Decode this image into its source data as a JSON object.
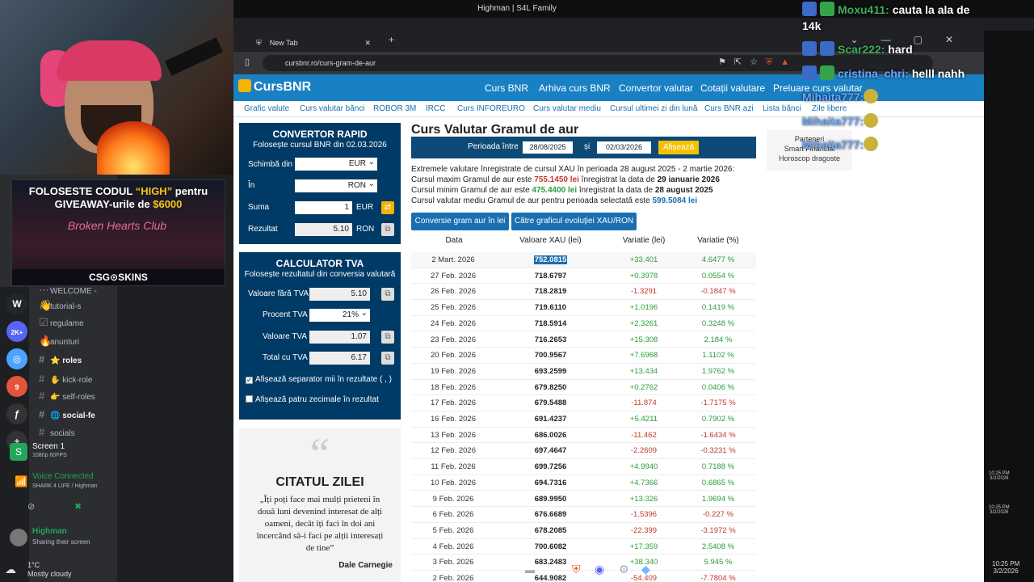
{
  "window_title": "Highman | S4L Family",
  "browser": {
    "tab_title": "New Tab",
    "url": "cursbnr.ro/curs-gram-de-aur"
  },
  "promo": {
    "line1_pre": "FOLOSESTE CODUL ",
    "line1_code": "“HIGH”",
    "line1_post": " pentru",
    "line2_pre": "GIVEAWAY-urile de ",
    "line2_amount": "$6000",
    "club": "Broken Hearts Club",
    "brand": "CSG⊙SKINS"
  },
  "discord": {
    "channels": [
      {
        "icon": "⋯",
        "name": "WELCOME -",
        "bold": false
      },
      {
        "icon": "👋",
        "name": "tutorial-s",
        "bold": false
      },
      {
        "icon": "☑",
        "name": "regulame",
        "bold": false
      },
      {
        "icon": "🔥",
        "name": "anunturi",
        "bold": false
      },
      {
        "icon": "#",
        "name": "⭐ roles",
        "bold": true
      },
      {
        "icon": "#",
        "name": "✋ kick-role",
        "bold": false
      },
      {
        "icon": "#",
        "name": "👉 self-roles",
        "bold": false
      },
      {
        "icon": "#",
        "name": "🌐 social-fe",
        "bold": true
      },
      {
        "icon": "#",
        "name": "socials",
        "bold": false
      }
    ],
    "server_badges": [
      "2K+",
      "9",
      "2"
    ],
    "screen_title": "Screen 1",
    "screen_sub": "1080p 60FPS",
    "voice_title": "Voice Connected",
    "voice_sub": "SHARK 4 LIFE / Highman",
    "user_name": "Highman",
    "user_status": "Sharing their screen",
    "weather_temp": "1°C",
    "weather_desc": "Mostly cloudy"
  },
  "site": {
    "logo": "CursBNR",
    "nav": [
      "Curs BNR",
      "Arhiva curs BNR",
      "Convertor valutar",
      "Cotații valutare",
      "Preluare curs valutar"
    ],
    "subnav": [
      "Grafic valute",
      "Curs valutar bănci",
      "ROBOR 3M",
      "IRCC",
      "Curs INFOREURO",
      "Curs valutar mediu",
      "Cursul ultimei zi din lună",
      "Curs BNR azi",
      "Lista bănci",
      "Zile libere"
    ]
  },
  "convertor": {
    "title": "CONVERTOR RAPID",
    "subtitle": "Folosește cursul BNR din 02.03.2026",
    "from_label": "Schimbă din",
    "from_value": "EUR",
    "to_label": "În",
    "to_value": "RON",
    "sum_label": "Suma",
    "sum_value": "1",
    "sum_unit": "EUR",
    "result_label": "Rezultat",
    "result_value": "5.10",
    "result_unit": "RON"
  },
  "tva": {
    "title": "CALCULATOR TVA",
    "subtitle": "Folosește rezultatul din conversia valutară",
    "rows": [
      {
        "label": "Valoare fără TVA",
        "value": "5.10"
      },
      {
        "label": "Procent TVA",
        "value": "21%"
      },
      {
        "label": "Valoare TVA",
        "value": "1.07"
      },
      {
        "label": "Total cu TVA",
        "value": "6.17"
      }
    ],
    "chk1": "Afișează separator mii în rezultate ( , )",
    "chk2": "Afișează patru zecimale în rezultat"
  },
  "quote": {
    "mark": "“",
    "title": "CITATUL ZILEI",
    "text": "„Îți poți face mai mulți prieteni în două luni devenind interesat de alți oameni, decât îți faci în doi ani încercând să-i faci pe alții interesați de tine”",
    "author": "Dale Carnegie"
  },
  "main": {
    "title": "Curs Valutar Gramul de aur",
    "period_label": "Perioada între",
    "date_from": "28/08/2025",
    "and": "și",
    "date_to": "02/03/2026",
    "show_btn": "Afișează",
    "info1": "Extremele valutare înregistrate de cursul XAU în perioada 28 august 2025 - 2 martie 2026:",
    "info2_pre": "Cursul maxim Gramul de aur este ",
    "info2_val": "755.1450 lei",
    "info2_mid": " înregistrat la data de ",
    "info2_date": "29 ianuarie 2026",
    "info3_pre": "Cursul minim Gramul de aur este ",
    "info3_val": "475.4400 lei",
    "info3_mid": " înregistrat la data de ",
    "info3_date": "28 august 2025",
    "info4_pre": "Cursul valutar mediu Gramul de aur pentru perioada selectată este ",
    "info4_val": "599.5084 lei",
    "btn1": "Conversie gram aur în lei",
    "btn2": "Către graficul evoluției XAU/RON",
    "headers": [
      "Data",
      "Valoare XAU (lei)",
      "Variatie (lei)",
      "Variatie (%)"
    ],
    "rows": [
      [
        "2 Mart. 2026",
        "752.0815",
        "+33.401",
        "4.6477 %"
      ],
      [
        "27 Feb. 2026",
        "718.6797",
        "+0.3978",
        "0.0554 %"
      ],
      [
        "26 Feb. 2026",
        "718.2819",
        "-1.3291",
        "-0.1847 %"
      ],
      [
        "25 Feb. 2026",
        "719.6110",
        "+1.0196",
        "0.1419 %"
      ],
      [
        "24 Feb. 2026",
        "718.5914",
        "+2.3261",
        "0.3248 %"
      ],
      [
        "23 Feb. 2026",
        "716.2653",
        "+15.308",
        "2.184 %"
      ],
      [
        "20 Feb. 2026",
        "700.9567",
        "+7.6968",
        "1.1102 %"
      ],
      [
        "19 Feb. 2026",
        "693.2599",
        "+13.434",
        "1.9762 %"
      ],
      [
        "18 Feb. 2026",
        "679.8250",
        "+0.2762",
        "0.0406 %"
      ],
      [
        "17 Feb. 2026",
        "679.5488",
        "-11.874",
        "-1.7175 %"
      ],
      [
        "16 Feb. 2026",
        "691.4237",
        "+5.4211",
        "0.7902 %"
      ],
      [
        "13 Feb. 2026",
        "686.0026",
        "-11.462",
        "-1.6434 %"
      ],
      [
        "12 Feb. 2026",
        "697.4647",
        "-2.2609",
        "-0.3231 %"
      ],
      [
        "11 Feb. 2026",
        "699.7256",
        "+4.9940",
        "0.7188 %"
      ],
      [
        "10 Feb. 2026",
        "694.7316",
        "+4.7366",
        "0.6865 %"
      ],
      [
        "9 Feb. 2026",
        "689.9950",
        "+13.326",
        "1.9694 %"
      ],
      [
        "6 Feb. 2026",
        "676.6689",
        "-1.5396",
        "-0.227 %"
      ],
      [
        "5 Feb. 2026",
        "678.2085",
        "-22.399",
        "-3.1972 %"
      ],
      [
        "4 Feb. 2026",
        "700.6082",
        "+17.359",
        "2.5408 %"
      ],
      [
        "3 Feb. 2026",
        "683.2483",
        "+38.340",
        "5.945 %"
      ],
      [
        "2 Feb. 2026",
        "644.9082",
        "-54.409",
        "-7.7804 %"
      ]
    ]
  },
  "sideads": {
    "l1": "Parteneri",
    "l2": "Smart Financial",
    "l3": "Horoscop dragoste"
  },
  "chat": [
    {
      "user": "Moxu411:",
      "msg": " cauta la ala de",
      "cont": "14k"
    },
    {
      "user": "Scar222:",
      "msg": " hard"
    },
    {
      "user": "cristina_chri:",
      "msg": " helll nahh"
    },
    {
      "user": "Mihaita777:",
      "msg": ""
    },
    {
      "user": "Mihaita777:",
      "msg": ""
    },
    {
      "user": "Mihaita777:",
      "msg": ""
    }
  ],
  "clock": [
    {
      "time": "10:25 PM",
      "date": "3/2/2026"
    },
    {
      "time": "10:25 PM",
      "date": "3/2/2026"
    },
    {
      "time": "10:25 PM",
      "date": "3/2/2026"
    }
  ],
  "colors": {
    "site_blue": "#1a80c4",
    "panel_navy": "#003a66",
    "positive": "#2a9d3a",
    "negative": "#c0392b",
    "max_red": "#c0392b",
    "min_green": "#2a9d3a",
    "avg_blue": "#1a6fb0",
    "chat_user": "#3fae5a",
    "chat_user_blue": "#6aa6ff"
  }
}
